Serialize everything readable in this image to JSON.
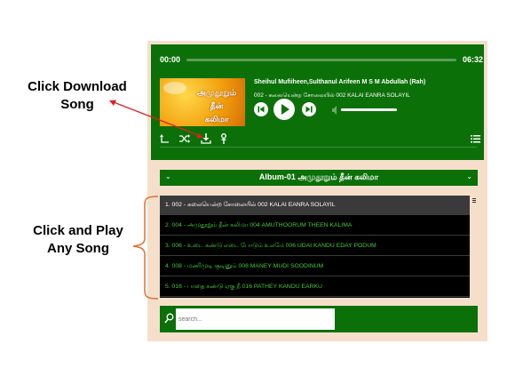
{
  "annotations": {
    "download_line1": "Click Download",
    "download_line2": "Song",
    "play_line1": "Click and Play",
    "play_line2": "Any Song",
    "color": "#e02020"
  },
  "player": {
    "current_time": "00:00",
    "total_time": "06:32",
    "progress": 0,
    "cover_text_line1": "அமுதூறும் தீன்",
    "cover_text_line2": "கலிமா",
    "artist": "Sheihul Mufiiheen,Sulthanul Arifeen M S M Abdullah (Rah)",
    "track": "002 - கலையென்ற சோலையில் 002 KALAI EANRA SOLAYIL",
    "volume": 0.9,
    "icons": [
      "repeat-icon",
      "shuffle-icon",
      "download-icon",
      "pin-icon",
      "playlist-icon",
      "prev-icon",
      "play-icon",
      "next-icon",
      "volume-icon"
    ],
    "colors": {
      "player_bg": "#0c7009",
      "widget_bg": "#f5dfcb",
      "active_row": "#3a3a3a",
      "track_text": "#46c93c"
    }
  },
  "album": {
    "title": "Album-01 அமுதூறும் தீன் கலிமா"
  },
  "tracks": [
    "1. 002 - கலையென்ற சோலையில் 002 KALAI EANRA SOLAYIL",
    "2. 004 - அமுதூறும் தீன் கலிமா 004 AMUTHOORUM THEEN KALIMA",
    "3. 006 - உடை கண்டு எடை போடும் உலமே 006 UDAI KANDU EDAY PODUM",
    "4. 008 - மணிமுடி சூடினும் 008 MANEY MUDI SOODINUM",
    "5. 016 - பாதை கண்டு ஏகு நீ 016 PATHEY KANDU EARKU"
  ],
  "active_track_index": 0,
  "search": {
    "placeholder": "search..."
  }
}
